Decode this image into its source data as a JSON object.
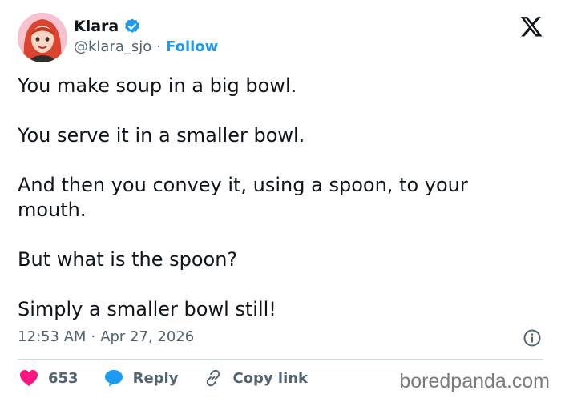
{
  "author": {
    "name": "Klara",
    "handle": "@klara_sjo",
    "separator": "·",
    "follow_label": "Follow"
  },
  "tweet": {
    "paragraphs": [
      "You make soup in a big bowl.",
      "You serve it in a smaller bowl.",
      "And then you convey it, using a spoon, to your mouth.",
      "But what is the spoon?",
      "Simply a smaller bowl still!"
    ],
    "time": "12:53 AM",
    "separator": "·",
    "date": "Apr 27, 2026"
  },
  "actions": {
    "like_count": "653",
    "reply_label": "Reply",
    "copy_link_label": "Copy link"
  },
  "watermark": "boredpanda.com",
  "colors": {
    "accent": "#1d9bf0",
    "like": "#f91880",
    "text": "#0f1419",
    "muted": "#536471"
  },
  "icons": {
    "verified": "verified-badge-icon",
    "brand": "x-logo-icon",
    "info": "info-icon",
    "like": "heart-icon",
    "reply": "speech-bubble-icon",
    "copy": "link-icon"
  }
}
